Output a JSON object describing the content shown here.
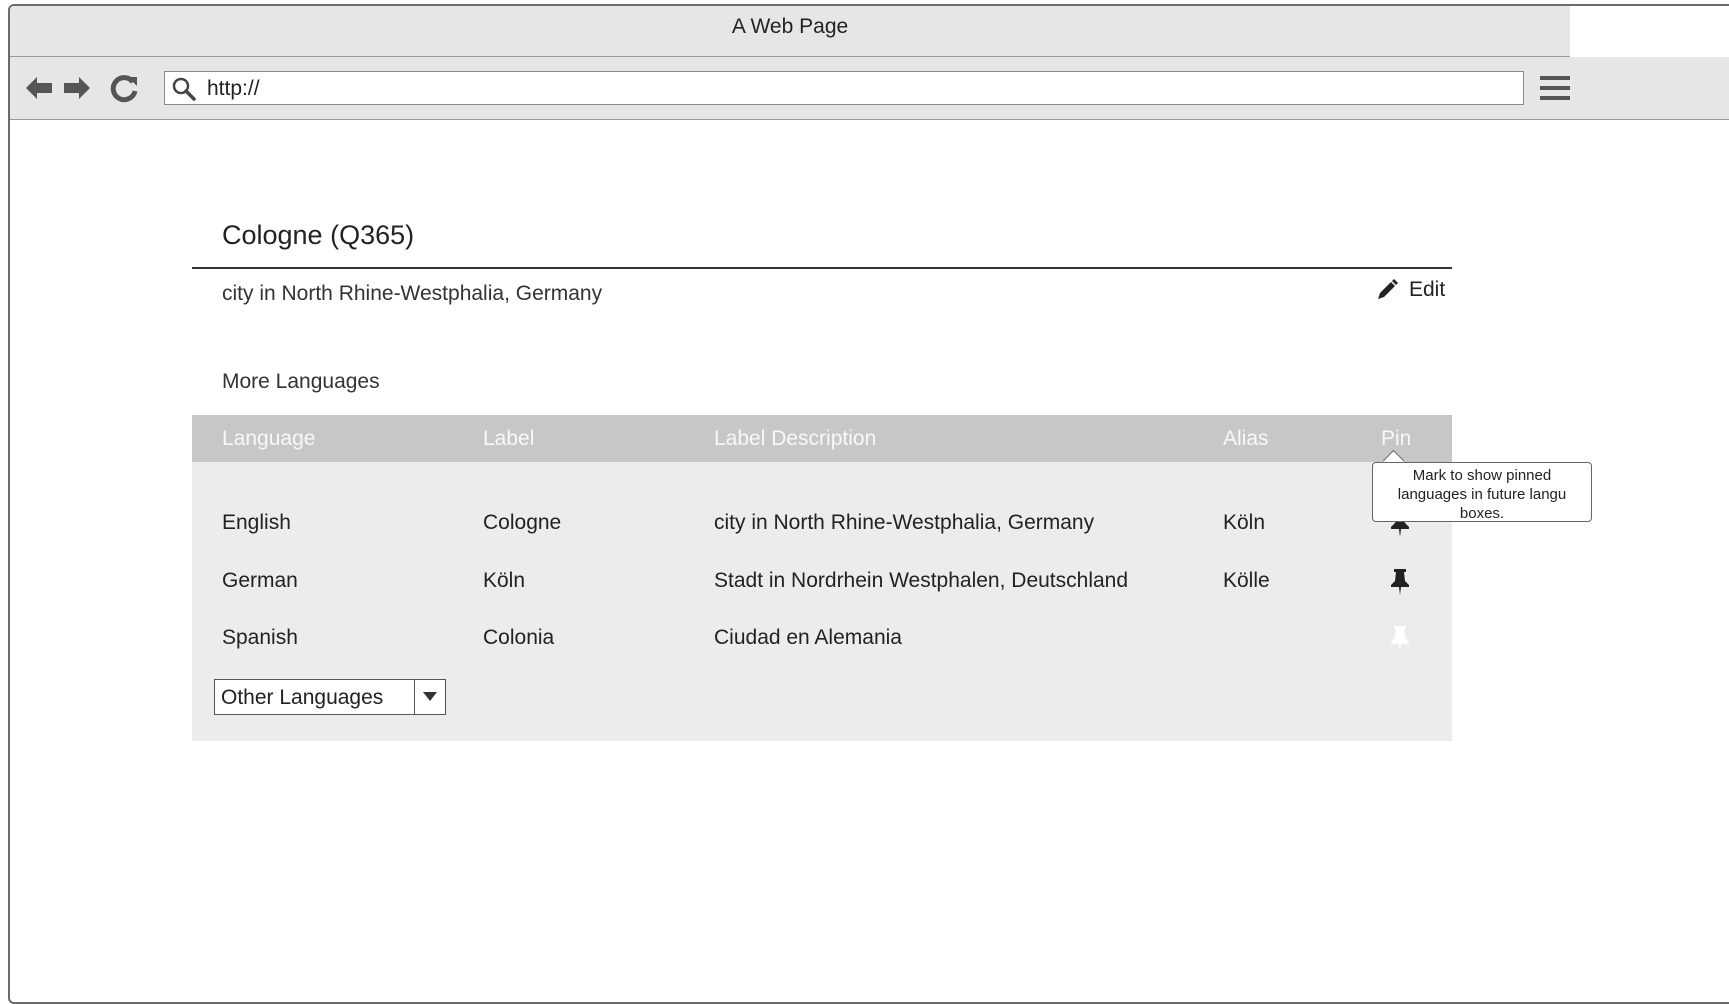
{
  "window": {
    "title": "A Web Page"
  },
  "toolbar": {
    "url_value": "http://",
    "icons": [
      "back-arrow-icon",
      "forward-arrow-icon",
      "reload-icon",
      "search-icon",
      "hamburger-menu-icon"
    ]
  },
  "page": {
    "title": "Cologne (Q365)",
    "description": "city in North Rhine-Westphalia, Germany",
    "edit_label": "Edit",
    "section_title": "More Languages"
  },
  "table": {
    "headers": {
      "language": "Language",
      "label": "Label",
      "description": "Label Description",
      "alias": "Alias",
      "pin": "Pin"
    },
    "rows": [
      {
        "language": "English",
        "label": "Cologne",
        "description": "city in North Rhine-Westphalia, Germany",
        "alias": "Köln",
        "pinned": true
      },
      {
        "language": "German",
        "label": "Köln",
        "description": "Stadt in Nordrhein Westphalen, Deutschland",
        "alias": "Kölle",
        "pinned": true
      },
      {
        "language": "Spanish",
        "label": "Colonia",
        "description": "Ciudad en Alemania",
        "alias": "",
        "pinned": false
      }
    ],
    "select": {
      "value": "Other Languages"
    }
  },
  "tooltip": {
    "lines": [
      "Mark to show pinned",
      "languages in future langu",
      "boxes."
    ]
  },
  "colors": {
    "header_bg": "#c7c7c7",
    "panel_bg": "#ececec",
    "pin_active": "#222222",
    "pin_inactive": "#ffffff"
  }
}
